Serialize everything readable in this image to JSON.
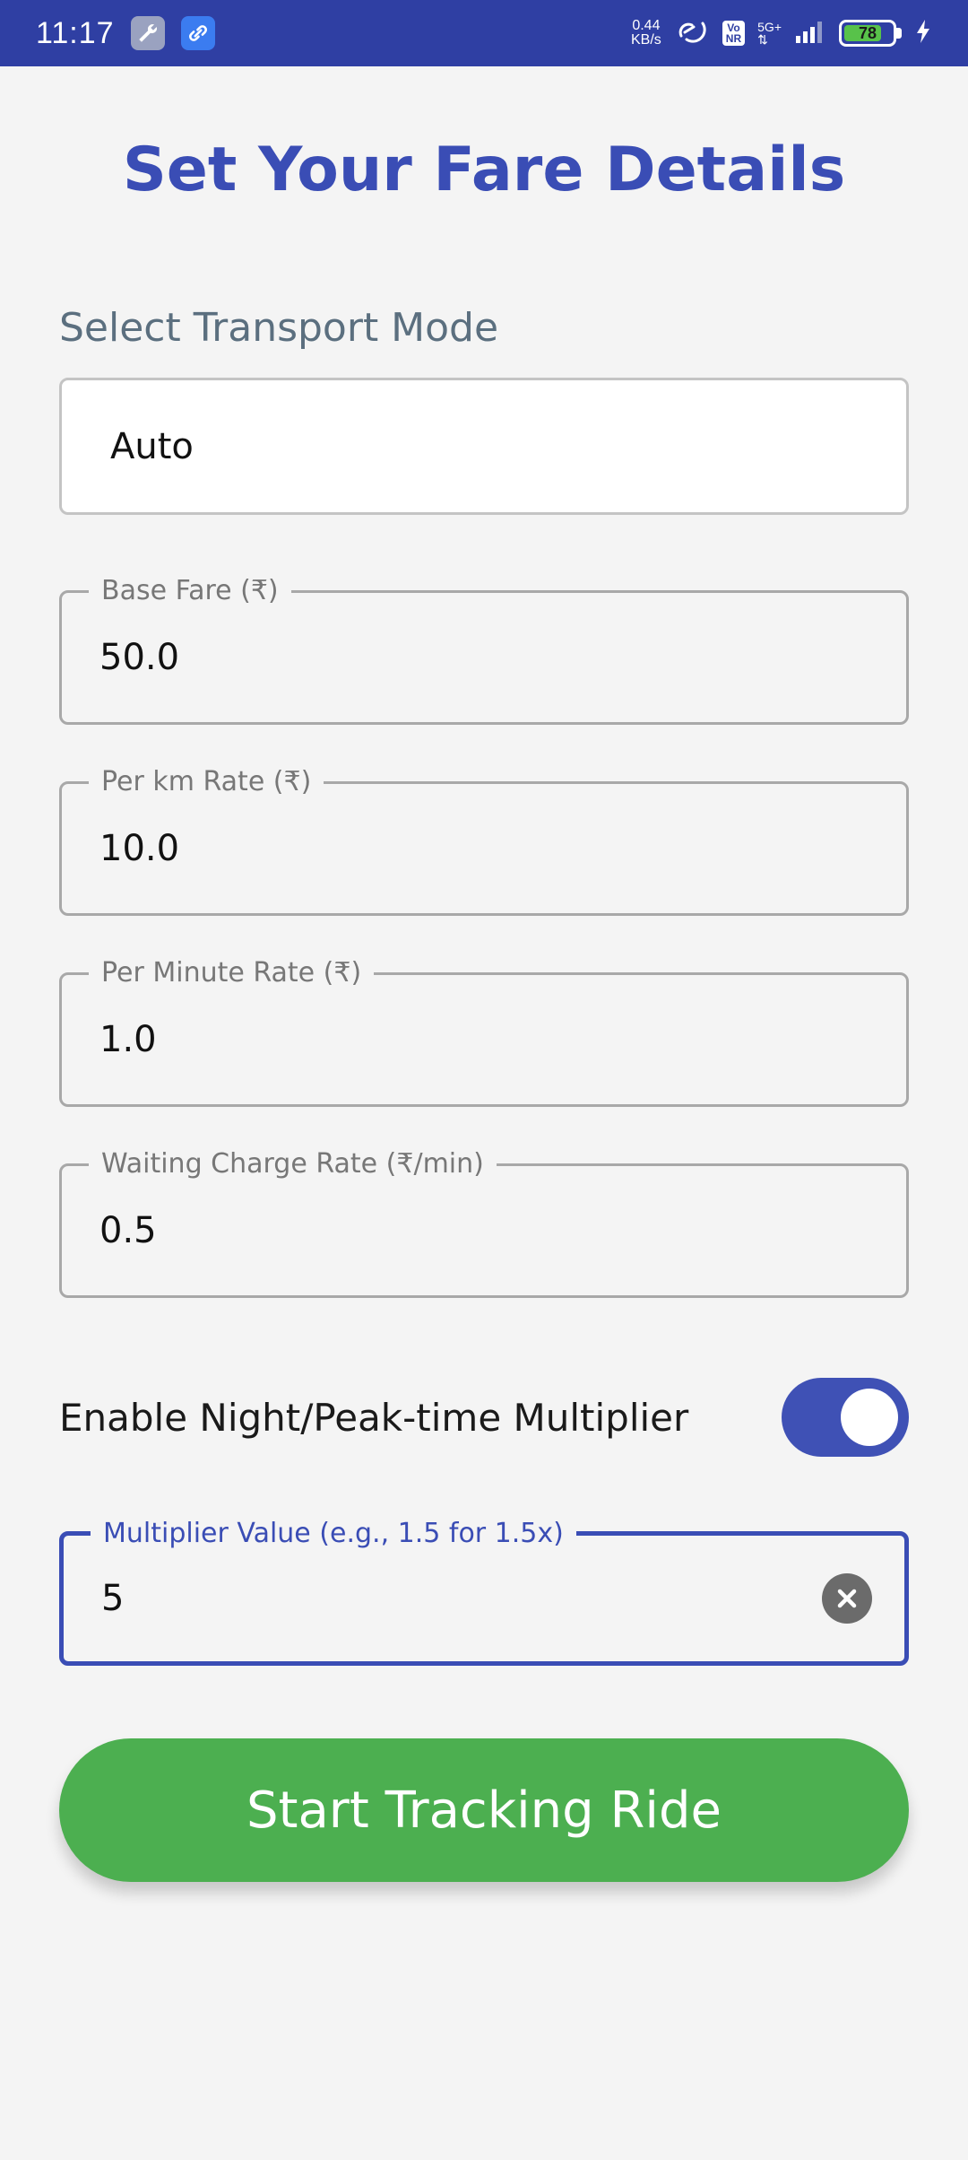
{
  "status_bar": {
    "time": "11:17",
    "network_speed_value": "0.44",
    "network_speed_unit": "KB/s",
    "volte_label_top": "Vo",
    "volte_label_bottom": "NR",
    "network_type": "5G+",
    "battery_level": "78",
    "battery_fraction": 0.78,
    "icons": [
      "wrench-icon",
      "link-icon",
      "hotspot-icon",
      "volte-icon",
      "signal-icon",
      "battery-icon",
      "charging-icon"
    ]
  },
  "header": {
    "title": "Set Your Fare Details"
  },
  "transport": {
    "label": "Select Transport Mode",
    "selected": "Auto"
  },
  "fields": {
    "base_fare": {
      "label": "Base Fare (₹)",
      "value": "50.0"
    },
    "per_km": {
      "label": "Per km Rate (₹)",
      "value": "10.0"
    },
    "per_minute": {
      "label": "Per Minute Rate (₹)",
      "value": "1.0"
    },
    "waiting": {
      "label": "Waiting Charge Rate (₹/min)",
      "value": "0.5"
    },
    "multiplier": {
      "label": "Multiplier Value (e.g., 1.5 for 1.5x)",
      "value": "5"
    }
  },
  "toggle": {
    "label": "Enable Night/Peak-time Multiplier",
    "enabled": true
  },
  "actions": {
    "start_label": "Start Tracking Ride"
  },
  "colors": {
    "status_bar": "#2f3fa3",
    "accent": "#3a4db5",
    "button": "#4caf50",
    "background": "#f4f4f4"
  }
}
